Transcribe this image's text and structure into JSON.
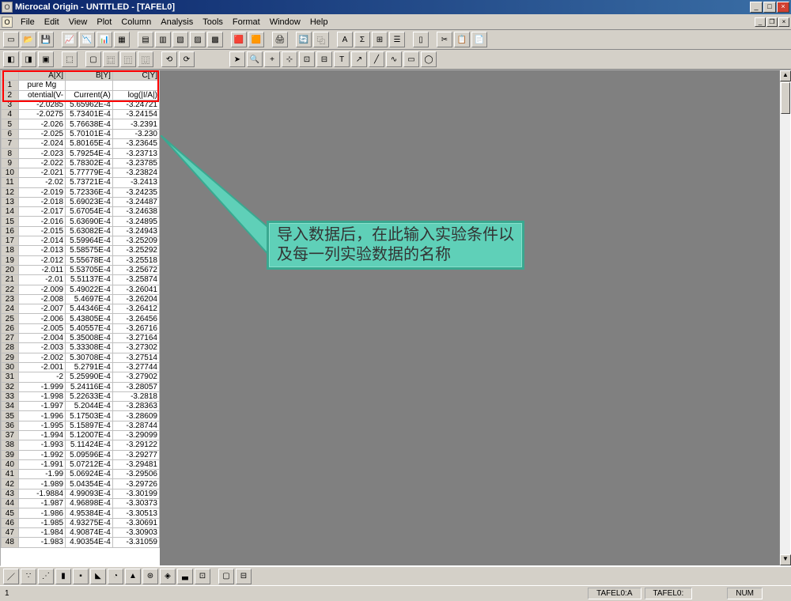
{
  "titlebar": {
    "title": "Microcal Origin - UNTITLED - [TAFEL0]"
  },
  "menubar": {
    "items": [
      "File",
      "Edit",
      "View",
      "Plot",
      "Column",
      "Analysis",
      "Tools",
      "Format",
      "Window",
      "Help"
    ]
  },
  "worksheet": {
    "cols": [
      {
        "header": "A[X]",
        "row1": "pure Mg",
        "row2": "otential(V-"
      },
      {
        "header": "B[Y]",
        "row1": "",
        "row2": "Current(A)"
      },
      {
        "header": "C[Y]",
        "row1": "",
        "row2": "log(|I/A|)"
      }
    ],
    "rows": [
      {
        "n": 3,
        "a": "-2.0285",
        "b": "5.65962E-4",
        "c": "-3.24721"
      },
      {
        "n": 4,
        "a": "-2.0275",
        "b": "5.73401E-4",
        "c": "-3.24154"
      },
      {
        "n": 5,
        "a": "-2.026",
        "b": "5.76638E-4",
        "c": "-3.2391"
      },
      {
        "n": 6,
        "a": "-2.025",
        "b": "5.70101E-4",
        "c": "-3.230"
      },
      {
        "n": 7,
        "a": "-2.024",
        "b": "5.80165E-4",
        "c": "-3.23645"
      },
      {
        "n": 8,
        "a": "-2.023",
        "b": "5.79254E-4",
        "c": "-3.23713"
      },
      {
        "n": 9,
        "a": "-2.022",
        "b": "5.78302E-4",
        "c": "-3.23785"
      },
      {
        "n": 10,
        "a": "-2.021",
        "b": "5.77779E-4",
        "c": "-3.23824"
      },
      {
        "n": 11,
        "a": "-2.02",
        "b": "5.73721E-4",
        "c": "-3.2413"
      },
      {
        "n": 12,
        "a": "-2.019",
        "b": "5.72336E-4",
        "c": "-3.24235"
      },
      {
        "n": 13,
        "a": "-2.018",
        "b": "5.69023E-4",
        "c": "-3.24487"
      },
      {
        "n": 14,
        "a": "-2.017",
        "b": "5.67054E-4",
        "c": "-3.24638"
      },
      {
        "n": 15,
        "a": "-2.016",
        "b": "5.63690E-4",
        "c": "-3.24895"
      },
      {
        "n": 16,
        "a": "-2.015",
        "b": "5.63082E-4",
        "c": "-3.24943"
      },
      {
        "n": 17,
        "a": "-2.014",
        "b": "5.59964E-4",
        "c": "-3.25209"
      },
      {
        "n": 18,
        "a": "-2.013",
        "b": "5.58575E-4",
        "c": "-3.25292"
      },
      {
        "n": 19,
        "a": "-2.012",
        "b": "5.55678E-4",
        "c": "-3.25518"
      },
      {
        "n": 20,
        "a": "-2.011",
        "b": "5.53705E-4",
        "c": "-3.25672"
      },
      {
        "n": 21,
        "a": "-2.01",
        "b": "5.51137E-4",
        "c": "-3.25874"
      },
      {
        "n": 22,
        "a": "-2.009",
        "b": "5.49022E-4",
        "c": "-3.26041"
      },
      {
        "n": 23,
        "a": "-2.008",
        "b": "5.4697E-4",
        "c": "-3.26204"
      },
      {
        "n": 24,
        "a": "-2.007",
        "b": "5.44346E-4",
        "c": "-3.26412"
      },
      {
        "n": 25,
        "a": "-2.006",
        "b": "5.43805E-4",
        "c": "-3.26456"
      },
      {
        "n": 26,
        "a": "-2.005",
        "b": "5.40557E-4",
        "c": "-3.26716"
      },
      {
        "n": 27,
        "a": "-2.004",
        "b": "5.35008E-4",
        "c": "-3.27164"
      },
      {
        "n": 28,
        "a": "-2.003",
        "b": "5.33308E-4",
        "c": "-3.27302"
      },
      {
        "n": 29,
        "a": "-2.002",
        "b": "5.30708E-4",
        "c": "-3.27514"
      },
      {
        "n": 30,
        "a": "-2.001",
        "b": "5.2791E-4",
        "c": "-3.27744"
      },
      {
        "n": 31,
        "a": "-2",
        "b": "5.25990E-4",
        "c": "-3.27902"
      },
      {
        "n": 32,
        "a": "-1.999",
        "b": "5.24116E-4",
        "c": "-3.28057"
      },
      {
        "n": 33,
        "a": "-1.998",
        "b": "5.22633E-4",
        "c": "-3.2818"
      },
      {
        "n": 34,
        "a": "-1.997",
        "b": "5.2044E-4",
        "c": "-3.28363"
      },
      {
        "n": 35,
        "a": "-1.996",
        "b": "5.17503E-4",
        "c": "-3.28609"
      },
      {
        "n": 36,
        "a": "-1.995",
        "b": "5.15897E-4",
        "c": "-3.28744"
      },
      {
        "n": 37,
        "a": "-1.994",
        "b": "5.12007E-4",
        "c": "-3.29099"
      },
      {
        "n": 38,
        "a": "-1.993",
        "b": "5.11424E-4",
        "c": "-3.29122"
      },
      {
        "n": 39,
        "a": "-1.992",
        "b": "5.09596E-4",
        "c": "-3.29277"
      },
      {
        "n": 40,
        "a": "-1.991",
        "b": "5.07212E-4",
        "c": "-3.29481"
      },
      {
        "n": 41,
        "a": "-1.99",
        "b": "5.06924E-4",
        "c": "-3.29506"
      },
      {
        "n": 42,
        "a": "-1.989",
        "b": "5.04354E-4",
        "c": "-3.29726"
      },
      {
        "n": 43,
        "a": "-1.9884",
        "b": "4.99093E-4",
        "c": "-3.30199"
      },
      {
        "n": 44,
        "a": "-1.987",
        "b": "4.96898E-4",
        "c": "-3.30373"
      },
      {
        "n": 45,
        "a": "-1.986",
        "b": "4.95384E-4",
        "c": "-3.30513"
      },
      {
        "n": 46,
        "a": "-1.985",
        "b": "4.93275E-4",
        "c": "-3.30691"
      },
      {
        "n": 47,
        "a": "-1.984",
        "b": "4.90874E-4",
        "c": "-3.30903"
      },
      {
        "n": 48,
        "a": "-1.983",
        "b": "4.90354E-4",
        "c": "-3.31059"
      }
    ]
  },
  "callout": {
    "text": "导入数据后，在此输入实验条件以及每一列实验数据的名称"
  },
  "statusbar": {
    "left": "1",
    "a": "TAFEL0:A",
    "b": "TAFEL0:",
    "num": "NUM"
  }
}
